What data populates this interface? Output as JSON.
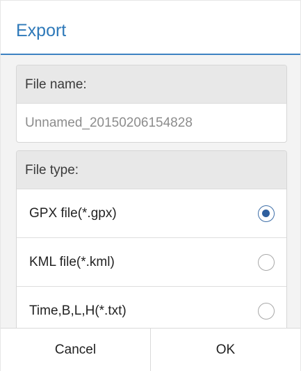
{
  "dialog": {
    "title": "Export",
    "filename": {
      "label": "File name:",
      "value": "Unnamed_20150206154828"
    },
    "filetype": {
      "label": "File type:",
      "options": [
        {
          "label": "GPX file(*.gpx)",
          "selected": true
        },
        {
          "label": "KML file(*.kml)",
          "selected": false
        },
        {
          "label": "Time,B,L,H(*.txt)",
          "selected": false
        }
      ]
    },
    "buttons": {
      "cancel": "Cancel",
      "ok": "OK"
    }
  },
  "colors": {
    "accent": "#2e79b9",
    "radio_checked": "#2f5f9e"
  }
}
